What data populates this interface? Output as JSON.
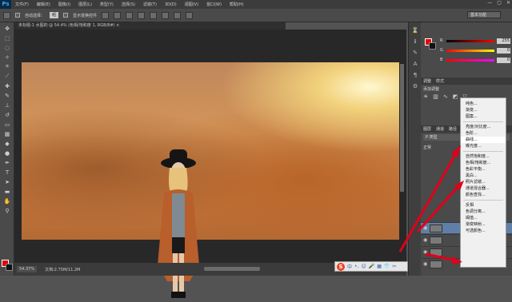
{
  "app": {
    "logo": "Ps"
  },
  "menubar": {
    "items": [
      "文件(F)",
      "编辑(E)",
      "图像(I)",
      "图层(L)",
      "类型(Y)",
      "选择(S)",
      "滤镜(T)",
      "3D(D)",
      "视图(V)",
      "窗口(W)",
      "帮助(H)"
    ],
    "controls": [
      "—",
      "▢",
      "✕"
    ]
  },
  "options": {
    "auto_select_label": "自动选择：",
    "auto_select_value": "组",
    "show_transform_label": "显示变换控件",
    "workspace": "基本功能"
  },
  "document": {
    "tab_title": "未标题-1 水图的 @ 54.4% (色相/饱和度 1, RGB/8#) ×",
    "zoom": "54.37%",
    "doc_size": "文档:2.75M/11.2M"
  },
  "ime": {
    "logo": "S",
    "items": [
      "中",
      "•,",
      "☺",
      "🎤",
      "▦",
      "👕",
      "✂"
    ]
  },
  "colors": {
    "foreground": "#e60000",
    "background": "#111111",
    "accent_arrow": "#e0001a"
  },
  "color_panel": {
    "sliders": [
      {
        "label": "R",
        "value": "255"
      },
      {
        "label": "G",
        "value": "0"
      },
      {
        "label": "B",
        "value": "0"
      }
    ]
  },
  "panel_tabs": {
    "top": [
      "调整",
      "样式"
    ],
    "layers": [
      "图层",
      "通道",
      "路径"
    ]
  },
  "adjustments": {
    "title": "添加调整"
  },
  "layers": {
    "blend_mode": "正常",
    "kind": "P 类型"
  },
  "adj_menu": {
    "groups": [
      [
        "纯色...",
        "渐变...",
        "图案..."
      ],
      [
        "亮度/对比度...",
        "色阶...",
        "曲线...",
        "曝光度..."
      ],
      [
        "自然饱和度...",
        "色相/饱和度...",
        "色彩平衡...",
        "黑白...",
        "照片滤镜...",
        "通道混合器...",
        "颜色查找..."
      ],
      [
        "反相",
        "色调分离...",
        "阈值...",
        "渐变映射...",
        "可选颜色..."
      ]
    ]
  }
}
